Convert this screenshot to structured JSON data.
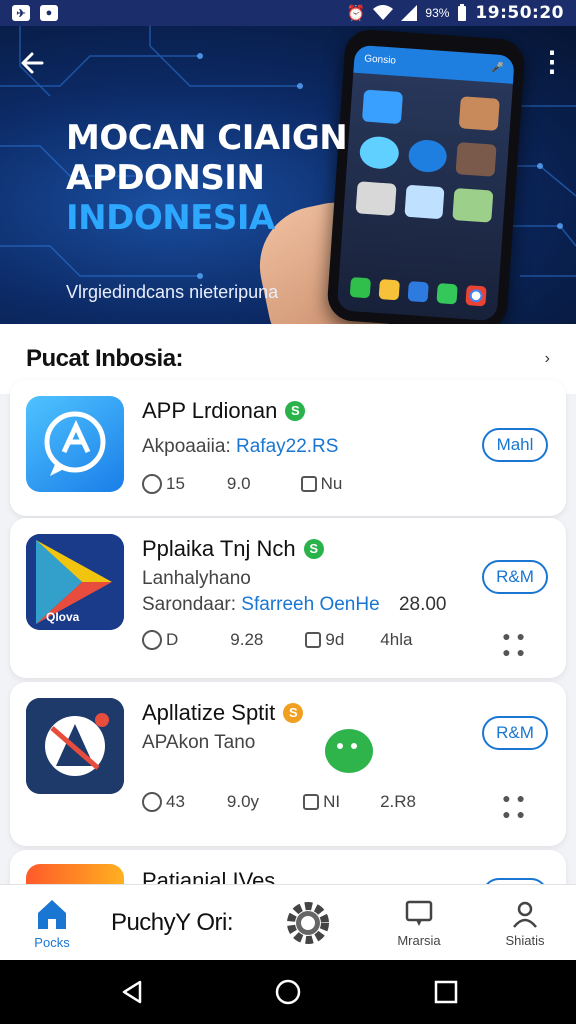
{
  "status_bar": {
    "time": "19:50:20",
    "battery": "93%",
    "icons": [
      "alarm-icon",
      "wifi-icon",
      "signal-icon",
      "battery-icon"
    ]
  },
  "hero": {
    "title_line1": "MOCAN CIAIGN",
    "title_line2": "APDONSIN",
    "title_line3": "INDONESIA",
    "subtitle": "Vlrgiedindcans nieteripuna",
    "phone_header": "Gonsio"
  },
  "section": {
    "title": "Pucat Inbosia:"
  },
  "apps": [
    {
      "name": "APP Lrdionan",
      "badge": "S",
      "badge_color": "#2bb34b",
      "line1_label": "Akpoaaiia:",
      "line1_link": "Rafay22.RS",
      "line2": "",
      "line2_label": "",
      "line2_link": "",
      "line2_num": "",
      "stat1": "15",
      "stat2": "9.0",
      "stat3": "Nu",
      "stat4": "",
      "button": "Mahl"
    },
    {
      "name": "Pplaika Tnj Nch",
      "badge": "S",
      "badge_color": "#2bb34b",
      "line1_label": "Lanhalyhano",
      "line1_link": "",
      "line2_label": "Sarondaar:",
      "line2_link": "Sfarreeh OenHe",
      "line2_num": "28.00",
      "stat1": "D",
      "stat2": "9.28",
      "stat3": "9d",
      "stat4": "4hla",
      "button": "R&M",
      "icon_text": "QIova"
    },
    {
      "name": "Apllatize Sptit",
      "badge": "S",
      "badge_color": "#f0a020",
      "line1_label": "APAkon Tano",
      "line1_link": "",
      "line2_label": "",
      "line2_link": "",
      "line2_num": "",
      "stat1": "43",
      "stat2": "9.0y",
      "stat3": "NI",
      "stat4": "2.R8",
      "button": "R&M"
    },
    {
      "name": "Patianial IVes"
    }
  ],
  "bottom_nav": [
    {
      "label": "Pocks",
      "icon": "home-icon",
      "active": true
    },
    {
      "label": "PuchyY Ori:",
      "icon": "",
      "active": false
    },
    {
      "label": "",
      "icon": "gear-icon",
      "active": false
    },
    {
      "label": "Mrarsia",
      "icon": "monitor-icon",
      "active": false
    },
    {
      "label": "Shiatis",
      "icon": "user-icon",
      "active": false
    }
  ],
  "colors": {
    "accent": "#1976d2",
    "status_bar": "#1b2d6b",
    "hero_dark": "#061534",
    "hero_blue": "#2ea7ff"
  }
}
